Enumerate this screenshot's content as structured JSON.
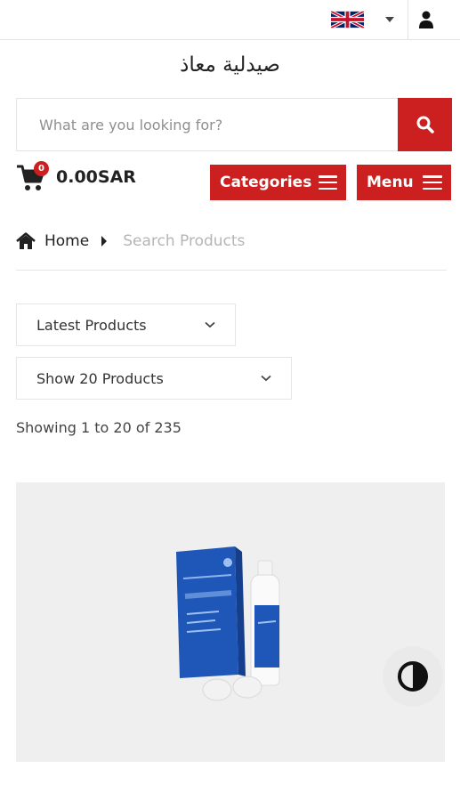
{
  "header": {
    "language": "English",
    "store_name": "صيدلية معاذ"
  },
  "search": {
    "placeholder": "What are you looking for?",
    "value": ""
  },
  "cart": {
    "count": "0",
    "total": "0.00SAR"
  },
  "nav": {
    "categories_label": "Categories",
    "menu_label": "Menu"
  },
  "breadcrumb": {
    "home": "Home",
    "current": "Search Products"
  },
  "filters": {
    "sort_selected": "Latest Products",
    "count_selected": "Show 20 Products"
  },
  "results": {
    "showing_text": "Showing 1 to 20 of 235"
  },
  "colors": {
    "accent": "#cc1f1f",
    "card_bg": "#efefef",
    "product_blue": "#1f57b8"
  },
  "icons": [
    "uk-flag-icon",
    "caret-down-icon",
    "user-icon",
    "search-icon",
    "cart-icon",
    "hamburger-icon",
    "home-icon",
    "chevron-right-icon",
    "chevron-down-icon",
    "contrast-icon"
  ]
}
